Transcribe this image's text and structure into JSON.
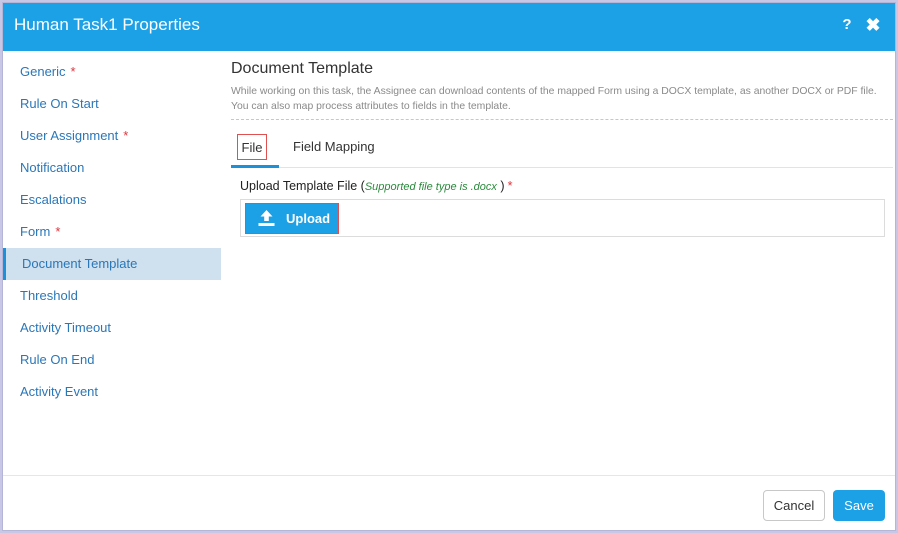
{
  "dialog": {
    "title": "Human Task1 Properties",
    "help_label": "?",
    "close_label": "✖"
  },
  "sidebar": {
    "items": [
      {
        "label": "Generic",
        "required": "*"
      },
      {
        "label": "Rule On Start",
        "required": ""
      },
      {
        "label": "User Assignment",
        "required": "*"
      },
      {
        "label": "Notification",
        "required": ""
      },
      {
        "label": "Escalations",
        "required": ""
      },
      {
        "label": "Form",
        "required": "*"
      },
      {
        "label": "Document Template",
        "required": "",
        "active": true
      },
      {
        "label": "Threshold",
        "required": ""
      },
      {
        "label": "Activity Timeout",
        "required": ""
      },
      {
        "label": "Rule On End",
        "required": ""
      },
      {
        "label": "Activity Event",
        "required": ""
      }
    ]
  },
  "main": {
    "title": "Document Template",
    "description": "While working on this task, the Assignee can download contents of the mapped Form using a DOCX template, as another DOCX or PDF file. You can also map process attributes to fields in the template.",
    "tabs": [
      {
        "label": "File",
        "active": true
      },
      {
        "label": "Field Mapping",
        "active": false
      }
    ],
    "upload": {
      "label": "Upload Template File (",
      "hint": "Supported file type is .docx",
      "label_end": " )",
      "required": "*",
      "button_label": "Upload"
    }
  },
  "footer": {
    "cancel_label": "Cancel",
    "save_label": "Save"
  },
  "colors": {
    "accent": "#1ca0e6",
    "nav_link": "#2a77b8",
    "required": "#e0343c",
    "hint": "#2a8a3c",
    "active_nav_bg": "#cfe0ef"
  }
}
